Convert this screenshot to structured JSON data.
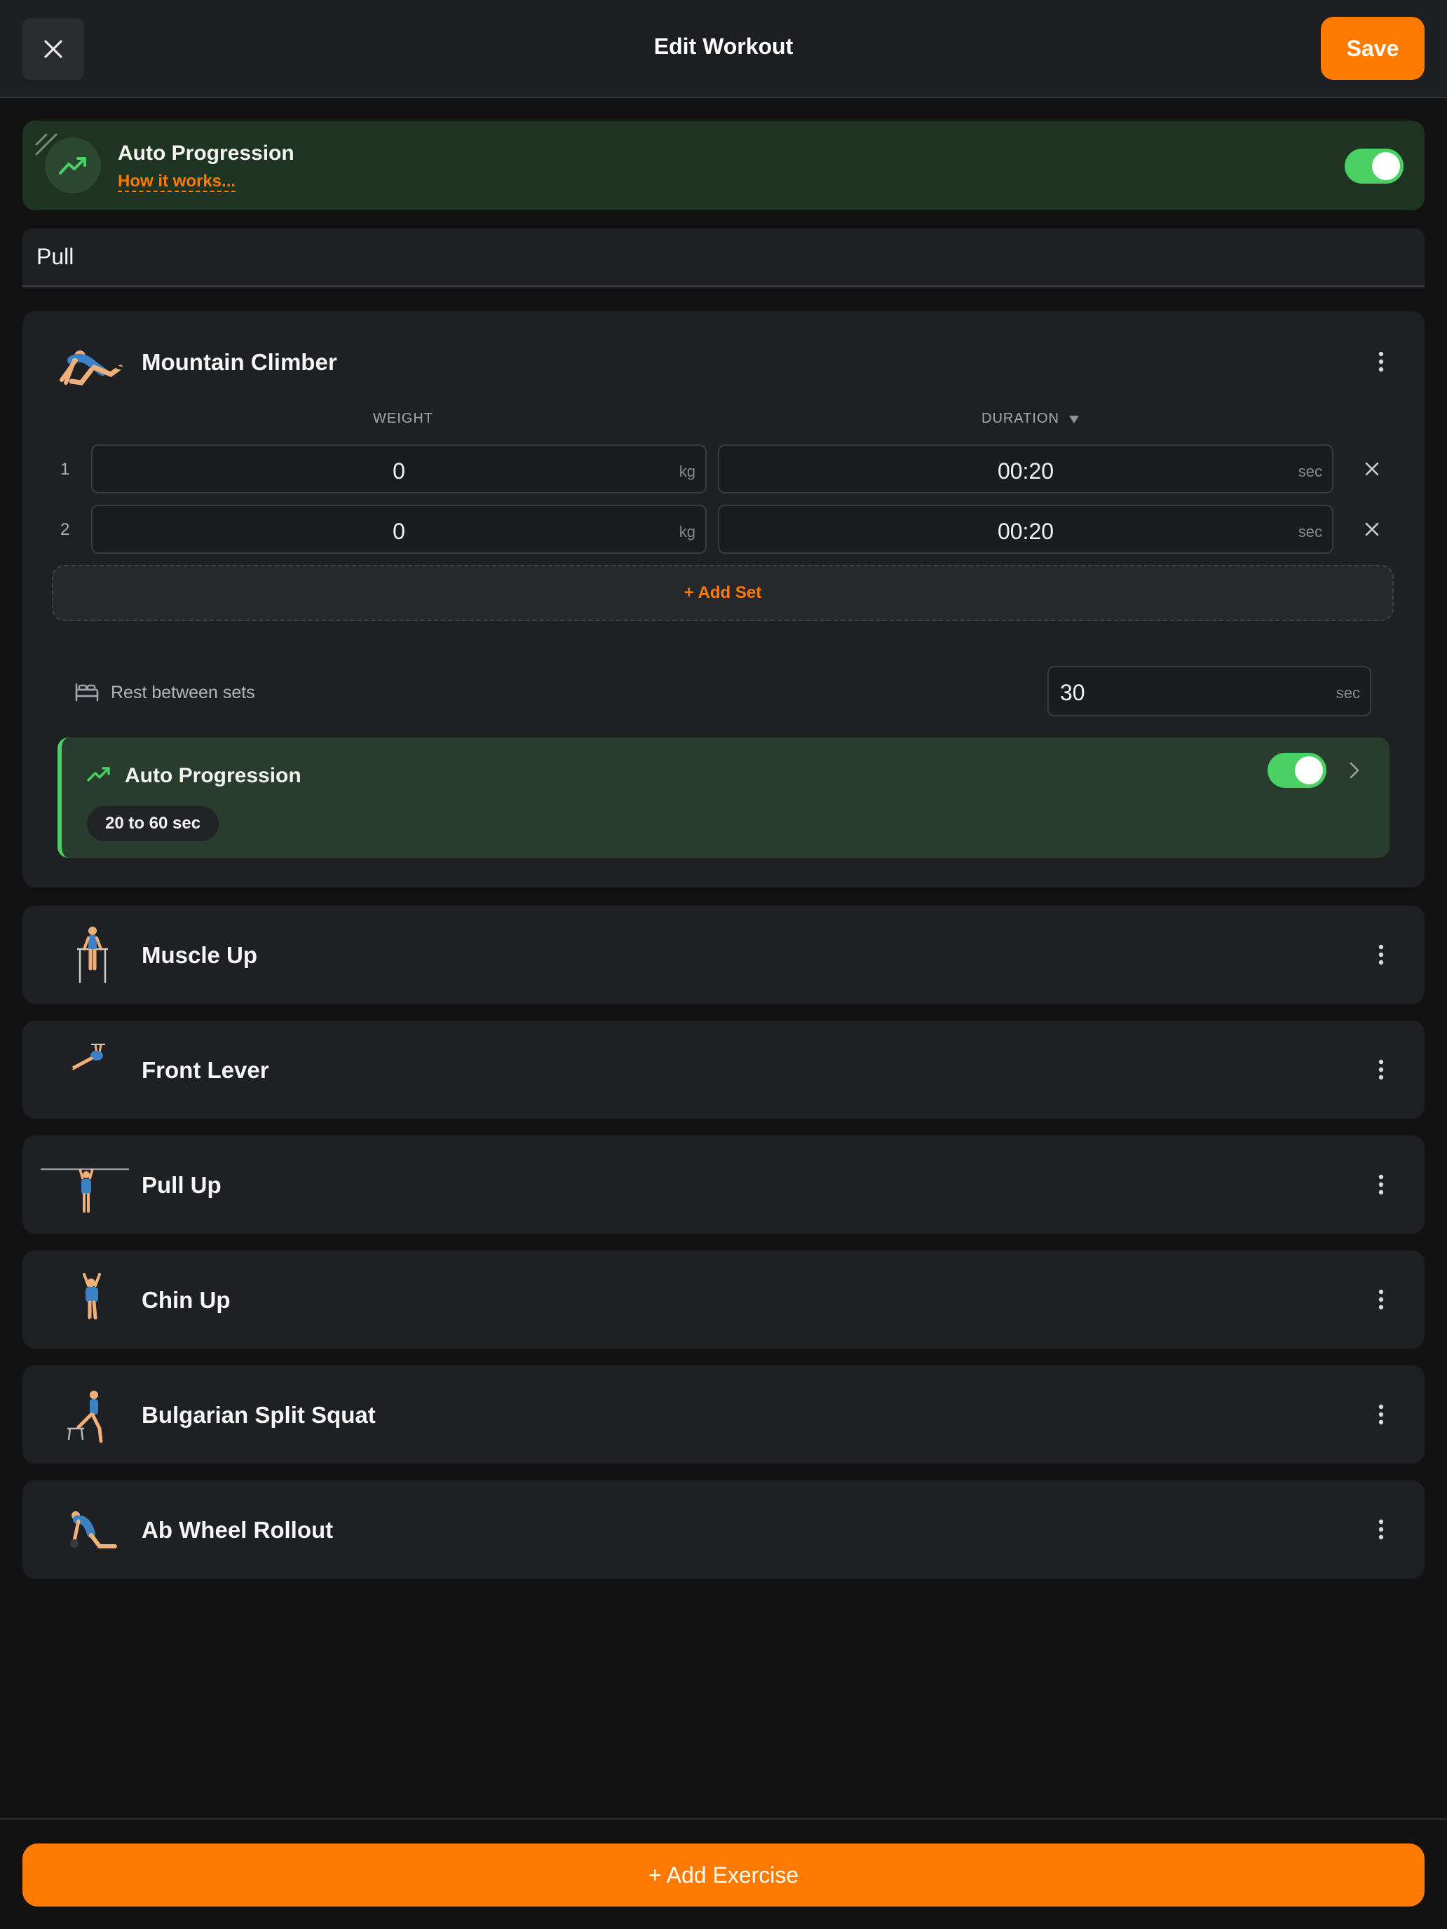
{
  "header": {
    "title": "Edit Workout",
    "save_label": "Save"
  },
  "auto_progression": {
    "title": "Auto Progression",
    "link": "How it works...",
    "enabled": true
  },
  "workout_name": "Pull",
  "expanded_exercise": {
    "name": "Mountain Climber",
    "columns": {
      "weight": "WEIGHT",
      "duration": "DURATION"
    },
    "sets": [
      {
        "num": "1",
        "weight": "0",
        "weight_unit": "kg",
        "duration": "00:20",
        "duration_unit": "sec"
      },
      {
        "num": "2",
        "weight": "0",
        "weight_unit": "kg",
        "duration": "00:20",
        "duration_unit": "sec"
      }
    ],
    "add_set_label": "+ Add Set",
    "rest_label": "Rest between sets",
    "rest_value": "30",
    "rest_unit": "sec",
    "auto_progression": {
      "title": "Auto Progression",
      "enabled": true,
      "range": "20 to 60 sec"
    }
  },
  "exercises": [
    {
      "name": "Muscle Up"
    },
    {
      "name": "Front Lever"
    },
    {
      "name": "Pull Up"
    },
    {
      "name": "Chin Up"
    },
    {
      "name": "Bulgarian Split Squat"
    },
    {
      "name": "Ab Wheel Rollout"
    }
  ],
  "footer": {
    "add_exercise_label": "+ Add Exercise"
  },
  "colors": {
    "accent": "#ff7a00",
    "toggle_on": "#4ad063",
    "background": "#121212",
    "card": "#1f2024"
  }
}
